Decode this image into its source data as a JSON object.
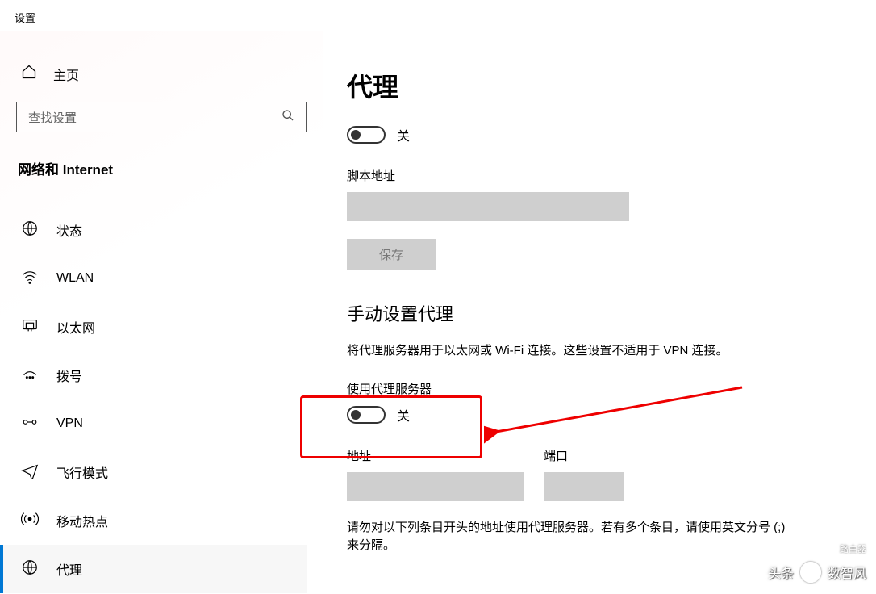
{
  "window": {
    "title": "设置"
  },
  "sidebar": {
    "home_label": "主页",
    "search_placeholder": "查找设置",
    "category": "网络和 Internet",
    "items": [
      {
        "label": "状态",
        "icon": "globe-icon"
      },
      {
        "label": "WLAN",
        "icon": "wifi-icon"
      },
      {
        "label": "以太网",
        "icon": "ethernet-icon"
      },
      {
        "label": "拨号",
        "icon": "dialup-icon"
      },
      {
        "label": "VPN",
        "icon": "vpn-icon"
      },
      {
        "label": "飞行模式",
        "icon": "airplane-icon"
      },
      {
        "label": "移动热点",
        "icon": "hotspot-icon"
      },
      {
        "label": "代理",
        "icon": "proxy-icon"
      }
    ]
  },
  "content": {
    "page_title": "代理",
    "auto_toggle_state": "关",
    "script_address_label": "脚本地址",
    "script_address_value": "",
    "save_label": "保存",
    "manual_section_title": "手动设置代理",
    "manual_desc": "将代理服务器用于以太网或 Wi-Fi 连接。这些设置不适用于 VPN 连接。",
    "use_proxy_label": "使用代理服务器",
    "use_proxy_state": "关",
    "address_label": "地址",
    "address_value": "",
    "port_label": "端口",
    "port_value": "",
    "exceptions_text": "请勿对以下列条目开头的地址使用代理服务器。若有多个条目，请使用英文分号 (;) 来分隔。"
  },
  "annotation": {
    "color": "#e00000"
  },
  "watermark": {
    "text1": "头条",
    "text2": "数智风",
    "small": "路由器"
  }
}
